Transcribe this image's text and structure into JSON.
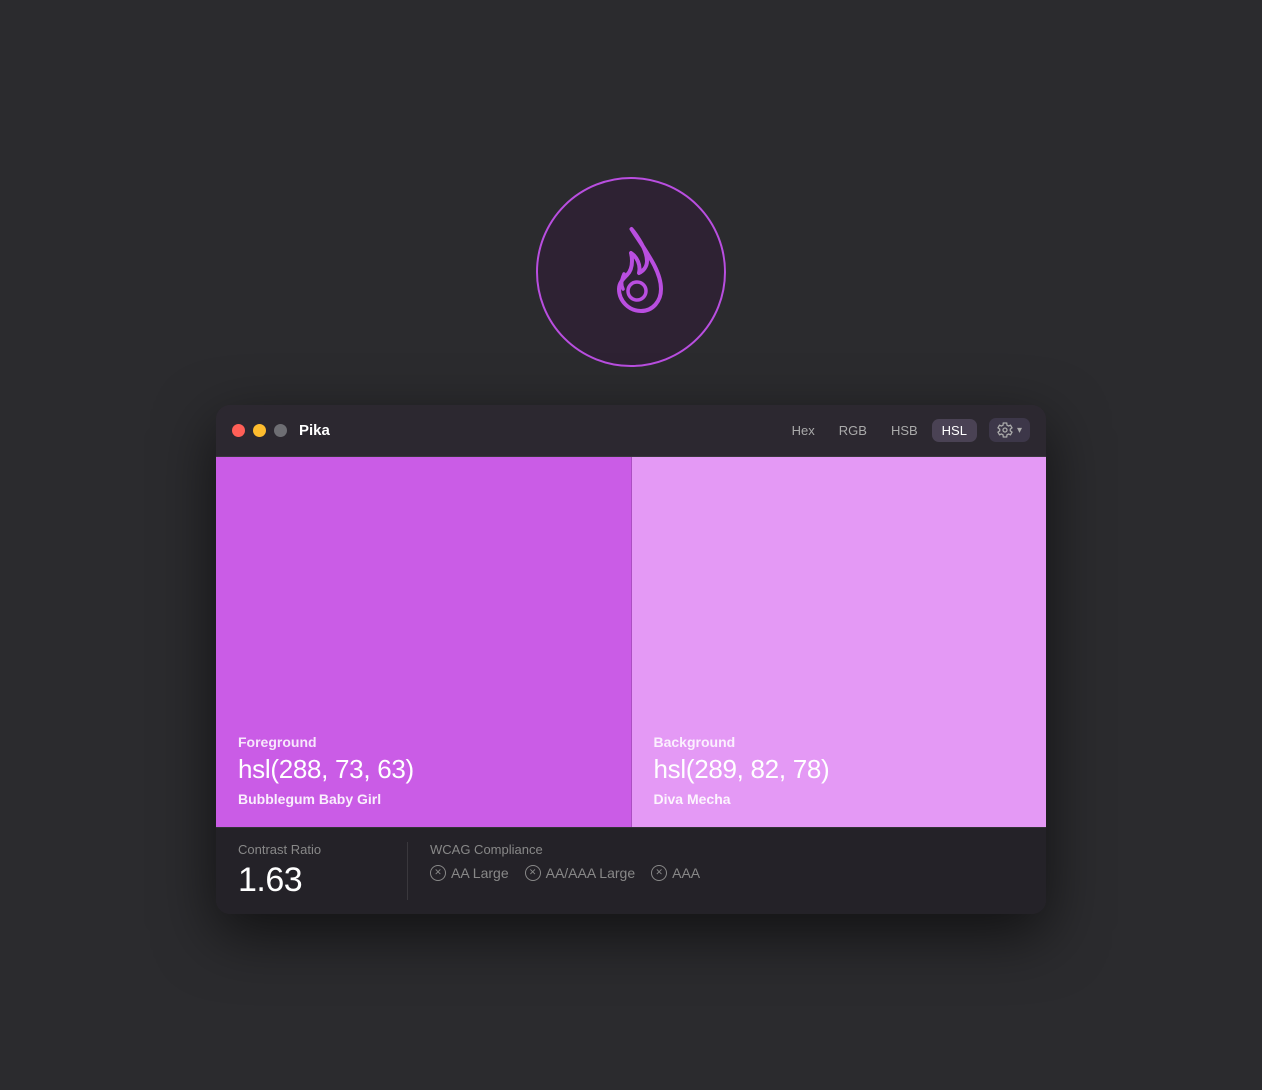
{
  "app": {
    "title": "Pika"
  },
  "format_tabs": [
    {
      "label": "Hex",
      "active": false
    },
    {
      "label": "RGB",
      "active": false
    },
    {
      "label": "HSB",
      "active": false
    },
    {
      "label": "HSL",
      "active": true
    }
  ],
  "settings_button_label": "⚙",
  "foreground": {
    "label": "Foreground",
    "value": "hsl(288, 73, 63)",
    "name": "Bubblegum Baby Girl",
    "hsl": "hsl(288, 73%, 63%)"
  },
  "background": {
    "label": "Background",
    "value": "hsl(289, 82, 78)",
    "name": "Diva Mecha",
    "hsl": "hsl(289, 82%, 78%)"
  },
  "contrast": {
    "label": "Contrast Ratio",
    "value": "1.63"
  },
  "wcag": {
    "label": "WCAG Compliance",
    "badges": [
      {
        "label": "AA Large"
      },
      {
        "label": "AA/AAA Large"
      },
      {
        "label": "AAA"
      }
    ]
  },
  "traffic_lights": {
    "close": "close",
    "minimize": "minimize",
    "maximize": "maximize"
  }
}
